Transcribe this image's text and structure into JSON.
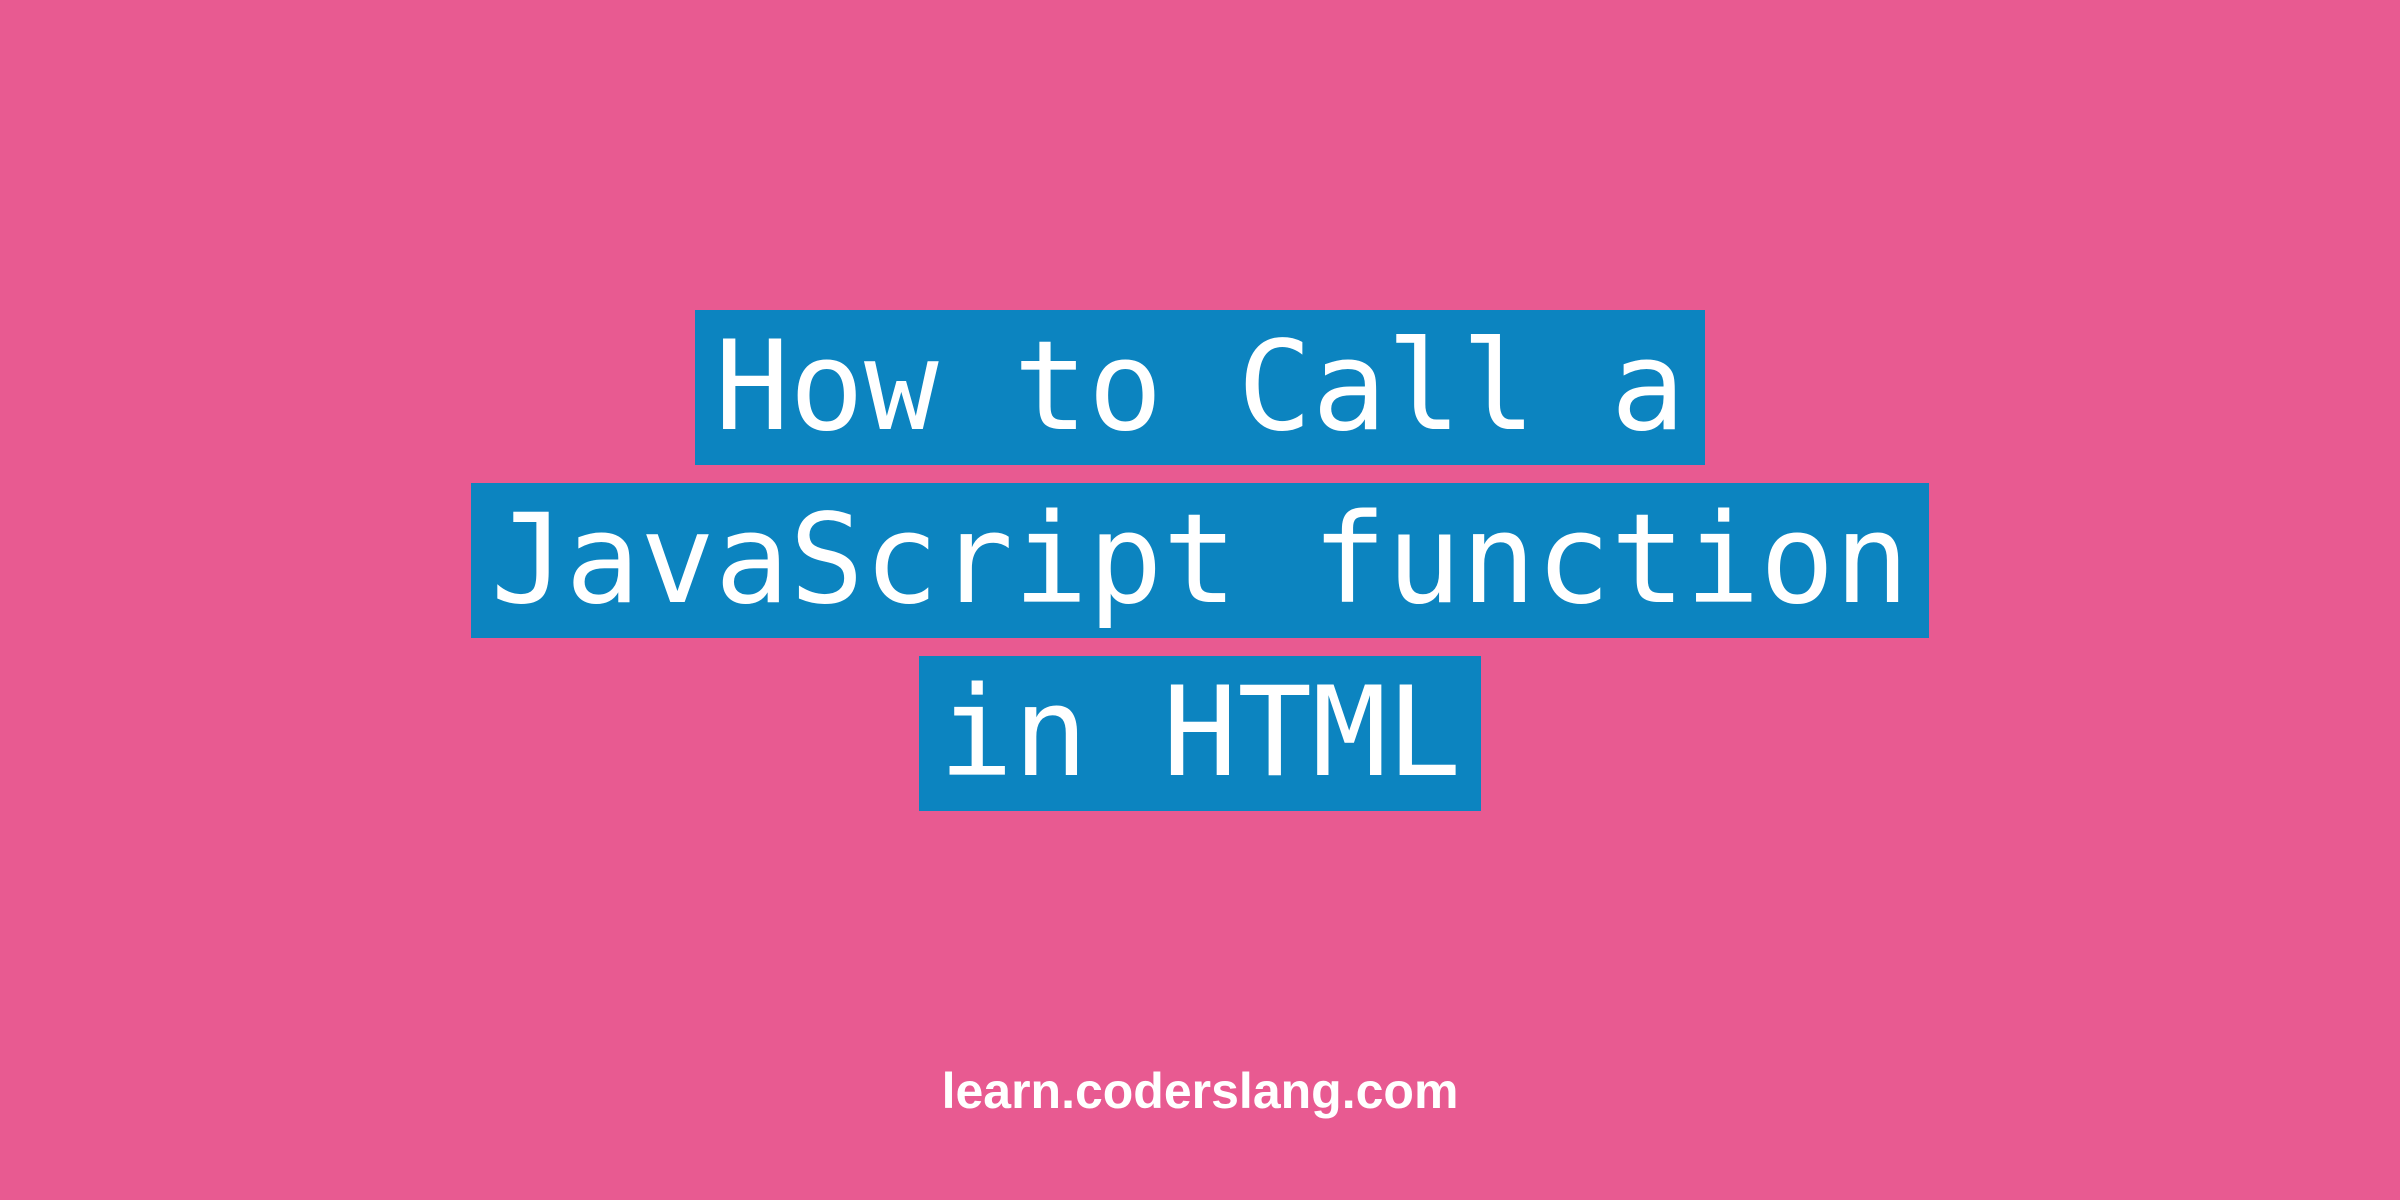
{
  "title": {
    "lines": [
      "How to Call a",
      "JavaScript function",
      "in HTML"
    ]
  },
  "footer": {
    "text": "learn.coderslang.com"
  },
  "colors": {
    "background": "#e85a91",
    "highlight": "#0c84c0",
    "text": "#ffffff"
  }
}
